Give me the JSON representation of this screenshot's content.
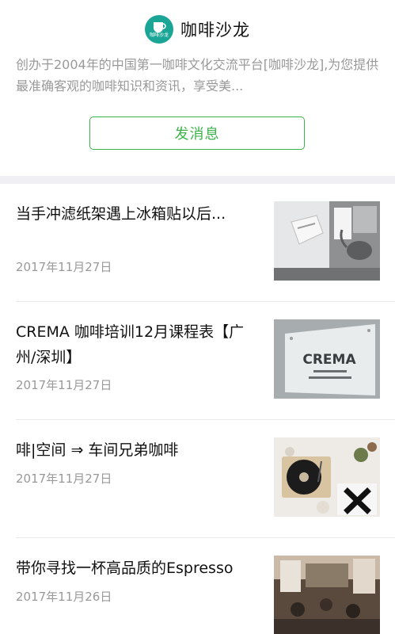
{
  "account": {
    "name": "咖啡沙龙",
    "logo_text": "咖啡沙龙",
    "description": "创办于2004年的中国第一咖啡文化交流平台[咖啡沙龙],为您提供最准确客观的咖啡知识和资讯，享受美...",
    "send_button": "发消息"
  },
  "articles": [
    {
      "title": "当手冲滤纸架遇上冰箱贴以后...",
      "date": "2017年11月27日",
      "thumb": "kettle-photo"
    },
    {
      "title": "CREMA 咖啡培训12月课程表【广州/深圳】",
      "date": "2017年11月27日",
      "thumb": "crema-sign-photo",
      "thumb_text": "CREMA"
    },
    {
      "title": "啡|空间 ⇒ 车间兄弟咖啡",
      "date": "2017年11月27日",
      "thumb": "record-player-photo"
    },
    {
      "title": "带你寻找一杯高品质的Espresso",
      "date": "2017年11月26日",
      "thumb": "cafe-interior-photo"
    }
  ],
  "colors": {
    "accent": "#3cb34a",
    "logo": "#1aa596",
    "muted": "#999999"
  }
}
